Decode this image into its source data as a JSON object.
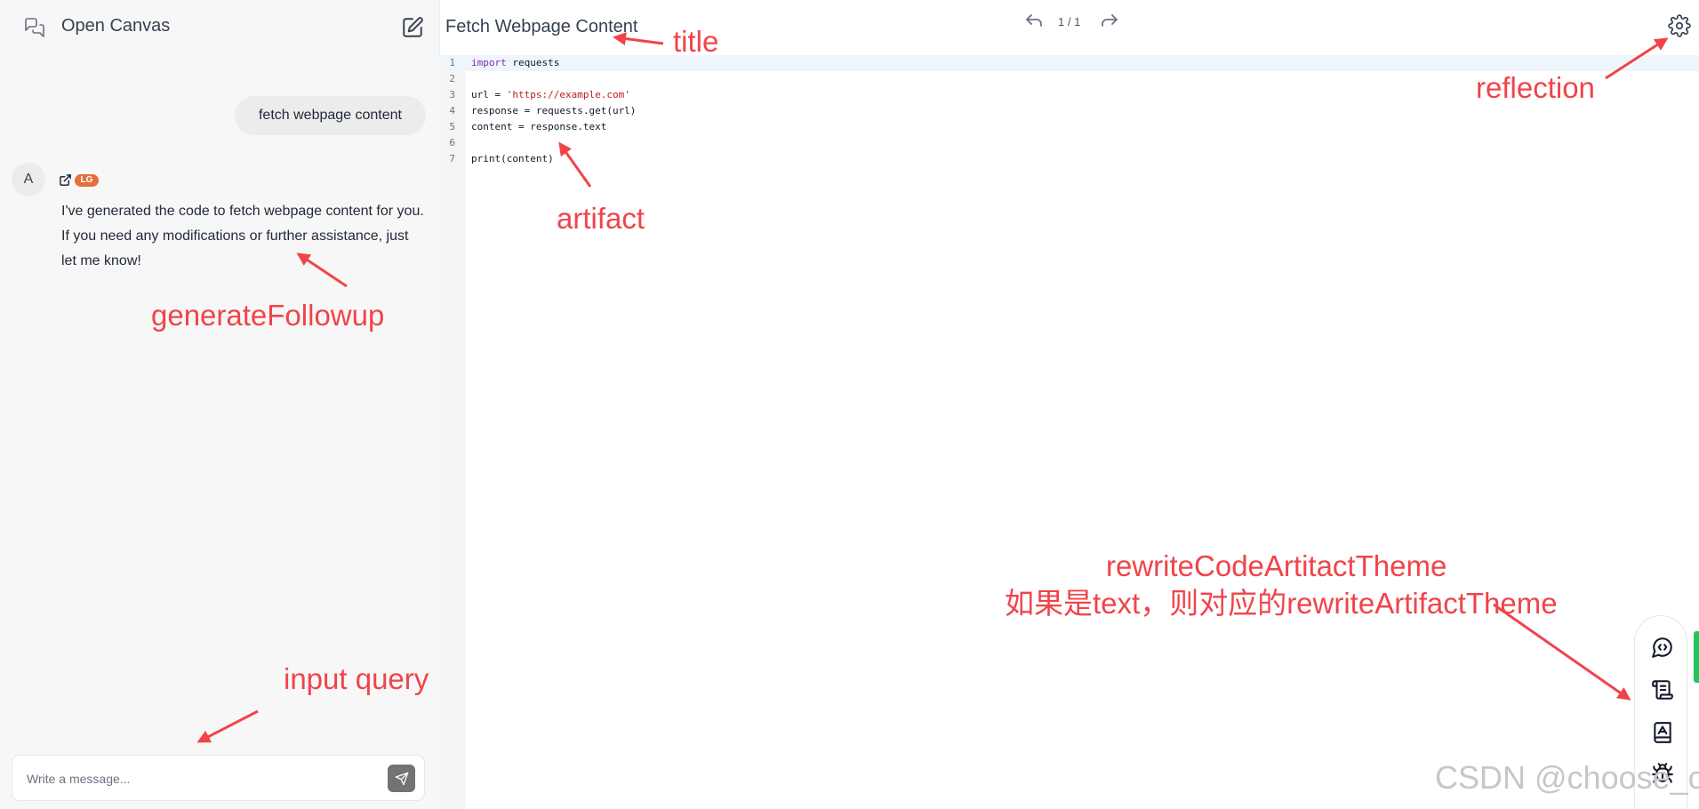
{
  "sidebar": {
    "title": "Open Canvas",
    "chat_icon": "chat-bubbles-icon",
    "new_chat_icon": "pencil-square-icon"
  },
  "conversation": {
    "user_message": "fetch webpage content",
    "assistant": {
      "avatar_letter": "A",
      "badge": "LG",
      "message": "I've generated the code to fetch webpage content for you. If you need any modifications or further assistance, just let me know!"
    }
  },
  "composer": {
    "placeholder": "Write a message...",
    "send_icon": "send-icon"
  },
  "artifact": {
    "title": "Fetch Webpage Content",
    "version": "1 / 1",
    "lines": [
      {
        "n": "1",
        "code": "import requests"
      },
      {
        "n": "2",
        "code": ""
      },
      {
        "n": "3",
        "code": "url = 'https://example.com'"
      },
      {
        "n": "4",
        "code": "response = requests.get(url)"
      },
      {
        "n": "5",
        "code": "content = response.text"
      },
      {
        "n": "6",
        "code": ""
      },
      {
        "n": "7",
        "code": "print(content)"
      }
    ]
  },
  "toolbar": {
    "icons": [
      "message-circle-code-icon",
      "scroll-text-icon",
      "book-a-icon",
      "bug-icon"
    ]
  },
  "annotations": {
    "title": "title",
    "reflection": "reflection",
    "artifact": "artifact",
    "generate_followup": "generateFollowup",
    "rewrite_line1": "rewriteCodeArtitactTheme",
    "rewrite_line2": "如果是text，则对应的rewriteArtifactTheme",
    "input_query": "input query",
    "color": "#f0444a"
  },
  "watermark": "CSDN @choose_c"
}
